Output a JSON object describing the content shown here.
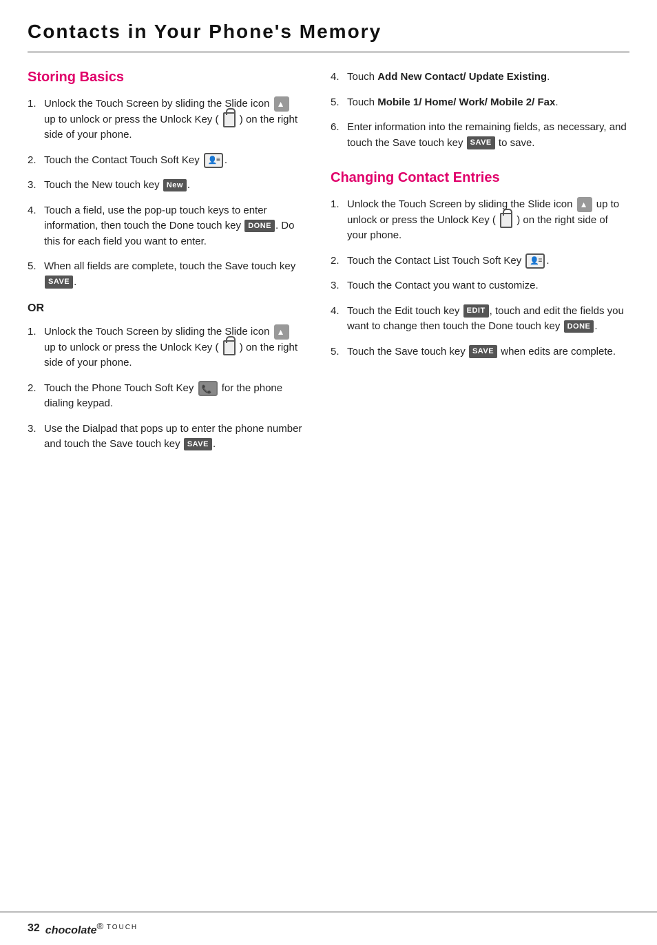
{
  "page": {
    "title": "Contacts in Your Phone's Memory",
    "footer": {
      "page_number": "32",
      "brand": "chocolate",
      "model": "TOUCH"
    }
  },
  "left_column": {
    "section_title": "Storing Basics",
    "items": [
      {
        "num": "1.",
        "text": "Unlock the Touch Screen by sliding the Slide icon",
        "icon_after": "slide-icon",
        "text_after": "up to unlock or press the Unlock Key (",
        "icon_after2": "unlock-icon",
        "text_after2": ") on the right side of your phone."
      },
      {
        "num": "2.",
        "text": "Touch the Contact Touch Soft Key",
        "icon_after": "contact-icon"
      },
      {
        "num": "3.",
        "text": "Touch the New touch key",
        "badge": "New"
      },
      {
        "num": "4.",
        "text": "Touch a field, use the pop-up touch keys to enter information, then touch the Done touch key",
        "badge": "DONE",
        "text_after": ". Do this for each field you want to enter."
      },
      {
        "num": "5.",
        "text": "When all fields are complete, touch the Save touch key",
        "badge": "SAVE"
      }
    ],
    "or_label": "OR",
    "or_items": [
      {
        "num": "1.",
        "text": "Unlock the Touch Screen by sliding the Slide icon",
        "icon_after": "slide-icon",
        "text_after": "up to unlock or press the Unlock Key (",
        "icon_after2": "unlock-icon",
        "text_after2": ") on the right side of your phone."
      },
      {
        "num": "2.",
        "text": "Touch the Phone Touch Soft Key",
        "icon_after": "phone-icon",
        "text_after": "for the phone dialing keypad."
      },
      {
        "num": "3.",
        "text": "Use the Dialpad that pops up to enter the phone number and touch the Save touch key",
        "badge": "SAVE",
        "text_after": "."
      }
    ]
  },
  "right_column": {
    "or_continuation": [
      {
        "num": "4.",
        "text_bold": "Add New Contact/ Update Existing",
        "text_before": "Touch",
        "text_after": "."
      },
      {
        "num": "5.",
        "text_before": "Touch",
        "text_bold": "Mobile 1/ Home/ Work/ Mobile 2/ Fax",
        "text_after": "."
      },
      {
        "num": "6.",
        "text": "Enter information into the remaining fields, as necessary, and touch the Save touch key",
        "badge": "SAVE",
        "text_after": "to save."
      }
    ],
    "section_title": "Changing Contact Entries",
    "items": [
      {
        "num": "1.",
        "text": "Unlock the Touch Screen by sliding the Slide icon",
        "icon_after": "slide-icon",
        "text_after": "up to unlock or press the Unlock Key (",
        "icon_after2": "unlock-icon",
        "text_after2": ") on the right side of your phone."
      },
      {
        "num": "2.",
        "text": "Touch the Contact List Touch Soft Key",
        "icon_after": "contact-icon"
      },
      {
        "num": "3.",
        "text": "Touch the Contact you want to customize."
      },
      {
        "num": "4.",
        "text": "Touch the Edit touch key",
        "badge": "EDIT",
        "text_after": ",  touch and edit the fields you want to change then touch the Done touch key",
        "badge2": "DONE",
        "text_after2": "."
      },
      {
        "num": "5.",
        "text": "Touch the Save touch key",
        "badge": "SAVE",
        "text_after": "when edits are complete."
      }
    ]
  },
  "badges": {
    "New": "New",
    "DONE": "DONE",
    "SAVE": "SAVE",
    "EDIT": "EDIT"
  }
}
